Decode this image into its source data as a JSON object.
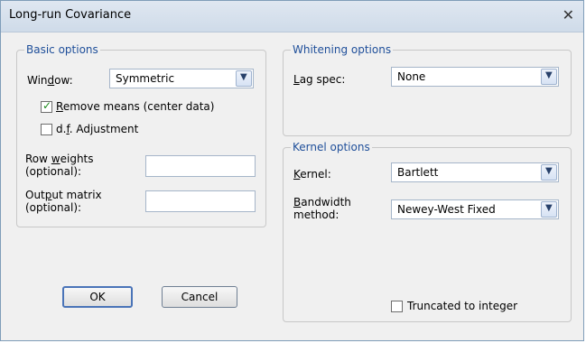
{
  "window": {
    "title": "Long-run Covariance",
    "close_icon": "close-icon"
  },
  "basic": {
    "legend": "Basic options",
    "window_label_pre": "Win",
    "window_label_u": "d",
    "window_label_post": "ow:",
    "window_value": "Symmetric",
    "remove_means_u": "R",
    "remove_means_post": "emove means (center data)",
    "remove_means_checked": true,
    "df_pre": "d.",
    "df_u": "f",
    "df_post": ". Adjustment",
    "df_checked": false,
    "row_weights_line1_pre": "Row ",
    "row_weights_line1_u": "w",
    "row_weights_line1_post": "eights",
    "row_weights_line2": "(optional):",
    "row_weights_value": "",
    "output_line1_pre": "Out",
    "output_line1_u": "p",
    "output_line1_post": "ut matrix",
    "output_line2": "(optional):",
    "output_value": ""
  },
  "buttons": {
    "ok": "OK",
    "cancel": "Cancel"
  },
  "whitening": {
    "legend": "Whitening options",
    "lag_u": "L",
    "lag_post": "ag spec:",
    "lag_value": "None"
  },
  "kernel": {
    "legend": "Kernel options",
    "kernel_u": "K",
    "kernel_post": "ernel:",
    "kernel_value": "Bartlett",
    "bw_line1_u": "B",
    "bw_line1_post": "andwidth",
    "bw_line2": "method:",
    "bw_value": "Newey-West Fixed",
    "truncated": "Truncated to integer",
    "truncated_checked": false
  },
  "icons": {
    "dropdown": "chevron-down-icon",
    "check": "checkmark-icon"
  }
}
